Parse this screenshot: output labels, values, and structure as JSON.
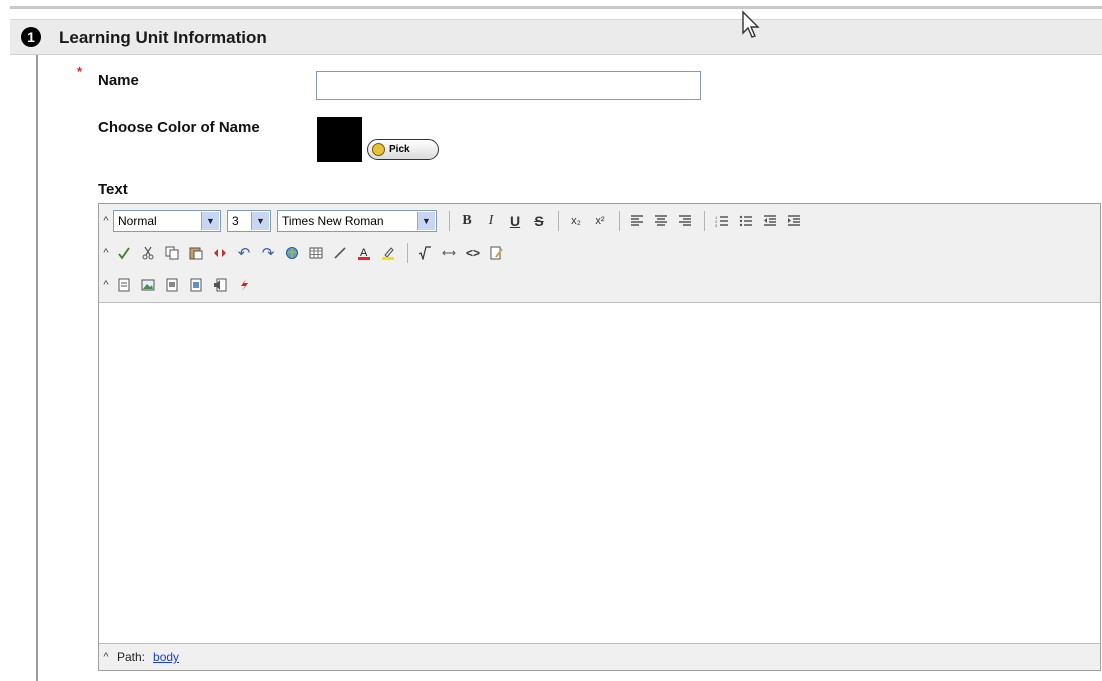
{
  "section": {
    "step": "1",
    "title": "Learning Unit Information"
  },
  "form": {
    "required_marker": "*",
    "name_label": "Name",
    "name_value": "",
    "color_label": "Choose Color of Name",
    "color_value": "#000000",
    "pick_label": "Pick",
    "text_label": "Text"
  },
  "editor": {
    "format_select": "Normal",
    "size_select": "3",
    "font_select": "Times New Roman",
    "path_label": "Path:",
    "path_link": "body",
    "content": ""
  },
  "icons": {
    "bold": "B",
    "italic": "I",
    "underline": "U",
    "strike": "S",
    "subscript": "x₂",
    "superscript": "x²",
    "undo": "↶",
    "redo": "↷",
    "source": "<>",
    "collapse": "^",
    "chevron": "▼"
  },
  "colors": {
    "required": "#dd2222",
    "link": "#1a3fcc",
    "header_bg": "#ebebeb"
  }
}
